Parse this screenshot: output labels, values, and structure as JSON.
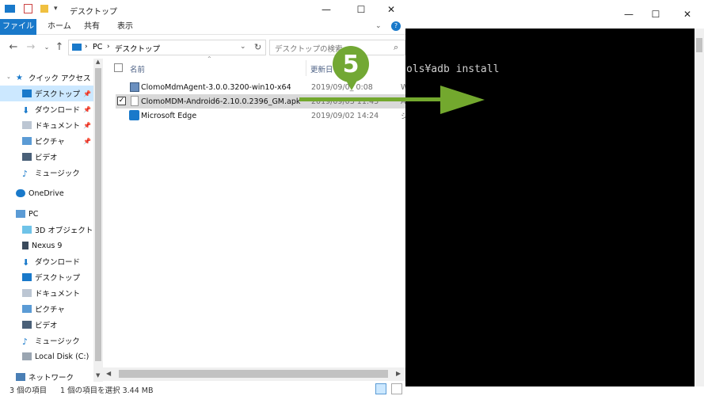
{
  "explorer": {
    "title": "デスクトップ",
    "ribbon_tabs": [
      "ファイル",
      "ホーム",
      "共有",
      "表示"
    ],
    "address_path": [
      "PC",
      "デスクトップ"
    ],
    "search_placeholder": "デスクトップの検索",
    "columns": {
      "name": "名前",
      "date": "更新日"
    },
    "nav": {
      "quick_access": "クイック アクセス",
      "qa_items": [
        "デスクトップ",
        "ダウンロード",
        "ドキュメント",
        "ピクチャ",
        "ビデオ",
        "ミュージック"
      ],
      "onedrive": "OneDrive",
      "pc": "PC",
      "pc_items": [
        "3D オブジェクト",
        "Nexus 9",
        "ダウンロード",
        "デスクトップ",
        "ドキュメント",
        "ピクチャ",
        "ビデオ",
        "ミュージック",
        "Local Disk (C:)"
      ],
      "network": "ネットワーク"
    },
    "files": [
      {
        "name": "ClomoMdmAgent-3.0.0.3200-win10-x64",
        "date": "2019/09/0_ 0:08",
        "extra": "W"
      },
      {
        "name": "ClomoMDM-Android6-2.10.0.2396_GM.apk",
        "date": "2019/09/03 11:43",
        "extra": "A"
      },
      {
        "name": "Microsoft Edge",
        "date": "2019/09/02 14:24",
        "extra": "シ"
      }
    ],
    "status": {
      "count": "3 個の項目",
      "selected": "1 個の項目を選択  3.44 MB"
    }
  },
  "console": {
    "text": "ols¥adb install"
  },
  "annotation": {
    "step": "5",
    "color": "#72a834"
  }
}
